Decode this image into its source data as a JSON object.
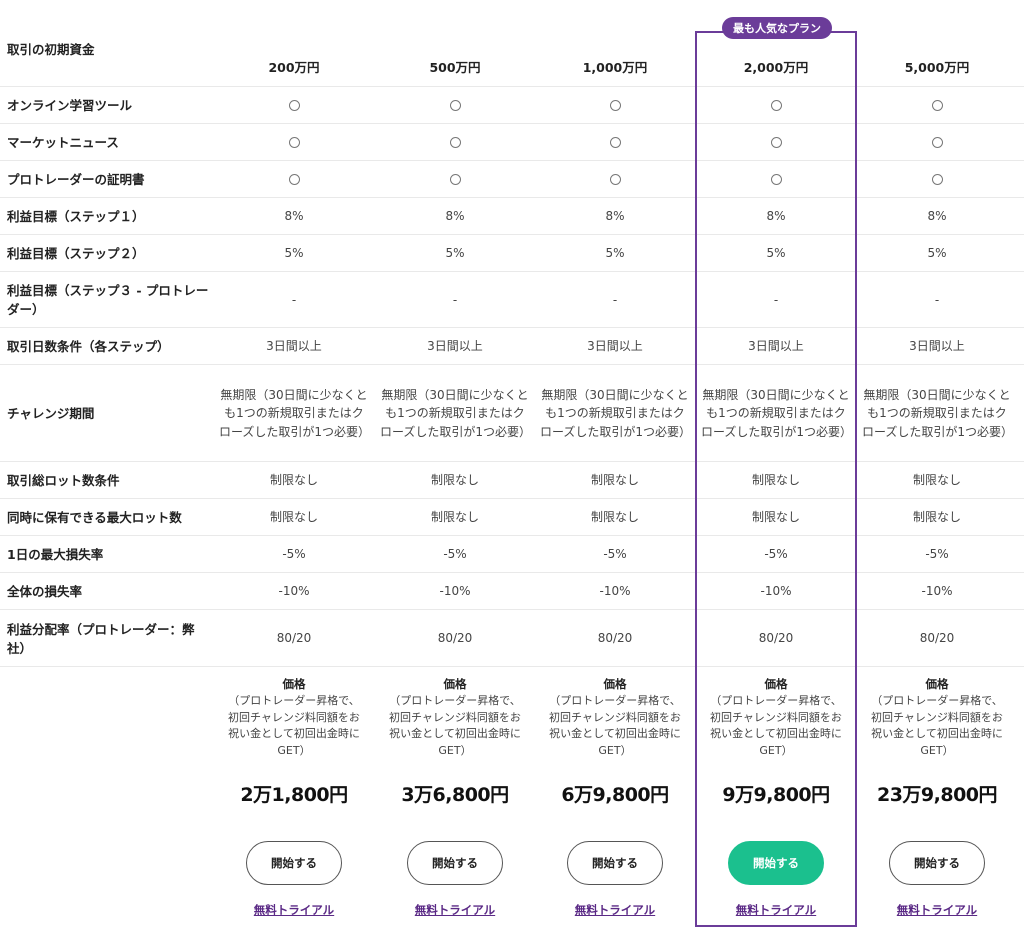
{
  "badge": "最も人気なプラン",
  "header_label": "取引の初期資金",
  "plans": [
    "200万円",
    "500万円",
    "1,000万円",
    "2,000万円",
    "5,000万円"
  ],
  "rows": [
    {
      "label": "オンライン学習ツール",
      "values": [
        "○",
        "○",
        "○",
        "○",
        "○"
      ],
      "type": "check"
    },
    {
      "label": "マーケットニュース",
      "values": [
        "○",
        "○",
        "○",
        "○",
        "○"
      ],
      "type": "check"
    },
    {
      "label": "プロトレーダーの証明書",
      "values": [
        "○",
        "○",
        "○",
        "○",
        "○"
      ],
      "type": "check"
    },
    {
      "label": "利益目標（ステップ１）",
      "values": [
        "8%",
        "8%",
        "8%",
        "8%",
        "8%"
      ]
    },
    {
      "label": "利益目標（ステップ２）",
      "values": [
        "5%",
        "5%",
        "5%",
        "5%",
        "5%"
      ]
    },
    {
      "label": "利益目標（ステップ３ - プロトレーダー）",
      "values": [
        "-",
        "-",
        "-",
        "-",
        "-"
      ]
    },
    {
      "label": "取引日数条件（各ステップ）",
      "values": [
        "3日間以上",
        "3日間以上",
        "3日間以上",
        "3日間以上",
        "3日間以上"
      ]
    },
    {
      "label": "チャレンジ期間",
      "values": [
        "無期限（30日間に少なくとも1つの新規取引またはクローズした取引が1つ必要）",
        "無期限（30日間に少なくとも1つの新規取引またはクローズした取引が1つ必要）",
        "無期限（30日間に少なくとも1つの新規取引またはクローズした取引が1つ必要）",
        "無期限（30日間に少なくとも1つの新規取引またはクローズした取引が1つ必要）",
        "無期限（30日間に少なくとも1つの新規取引またはクローズした取引が1つ必要）"
      ]
    },
    {
      "label": "取引総ロット数条件",
      "values": [
        "制限なし",
        "制限なし",
        "制限なし",
        "制限なし",
        "制限なし"
      ]
    },
    {
      "label": "同時に保有できる最大ロット数",
      "values": [
        "制限なし",
        "制限なし",
        "制限なし",
        "制限なし",
        "制限なし"
      ]
    },
    {
      "label": "1日の最大損失率",
      "values": [
        "-5%",
        "-5%",
        "-5%",
        "-5%",
        "-5%"
      ]
    },
    {
      "label": "全体の損失率",
      "values": [
        "-10%",
        "-10%",
        "-10%",
        "-10%",
        "-10%"
      ]
    },
    {
      "label": "利益分配率（プロトレーダー：弊社）",
      "values": [
        "80/20",
        "80/20",
        "80/20",
        "80/20",
        "80/20"
      ]
    }
  ],
  "price_title": "価格",
  "price_note": "（プロトレーダー昇格で、初回チャレンジ料同額をお祝い金として初回出金時にGET）",
  "prices": [
    "2万1,800円",
    "3万6,800円",
    "6万9,800円",
    "9万9,800円",
    "23万9,800円"
  ],
  "start_label": "開始する",
  "trial_label": "無料トライアル",
  "highlight_index": 3,
  "colors": {
    "accent": "#6b3c99",
    "primary_button": "#1bc08e",
    "trial_link": "#5b2a86"
  }
}
